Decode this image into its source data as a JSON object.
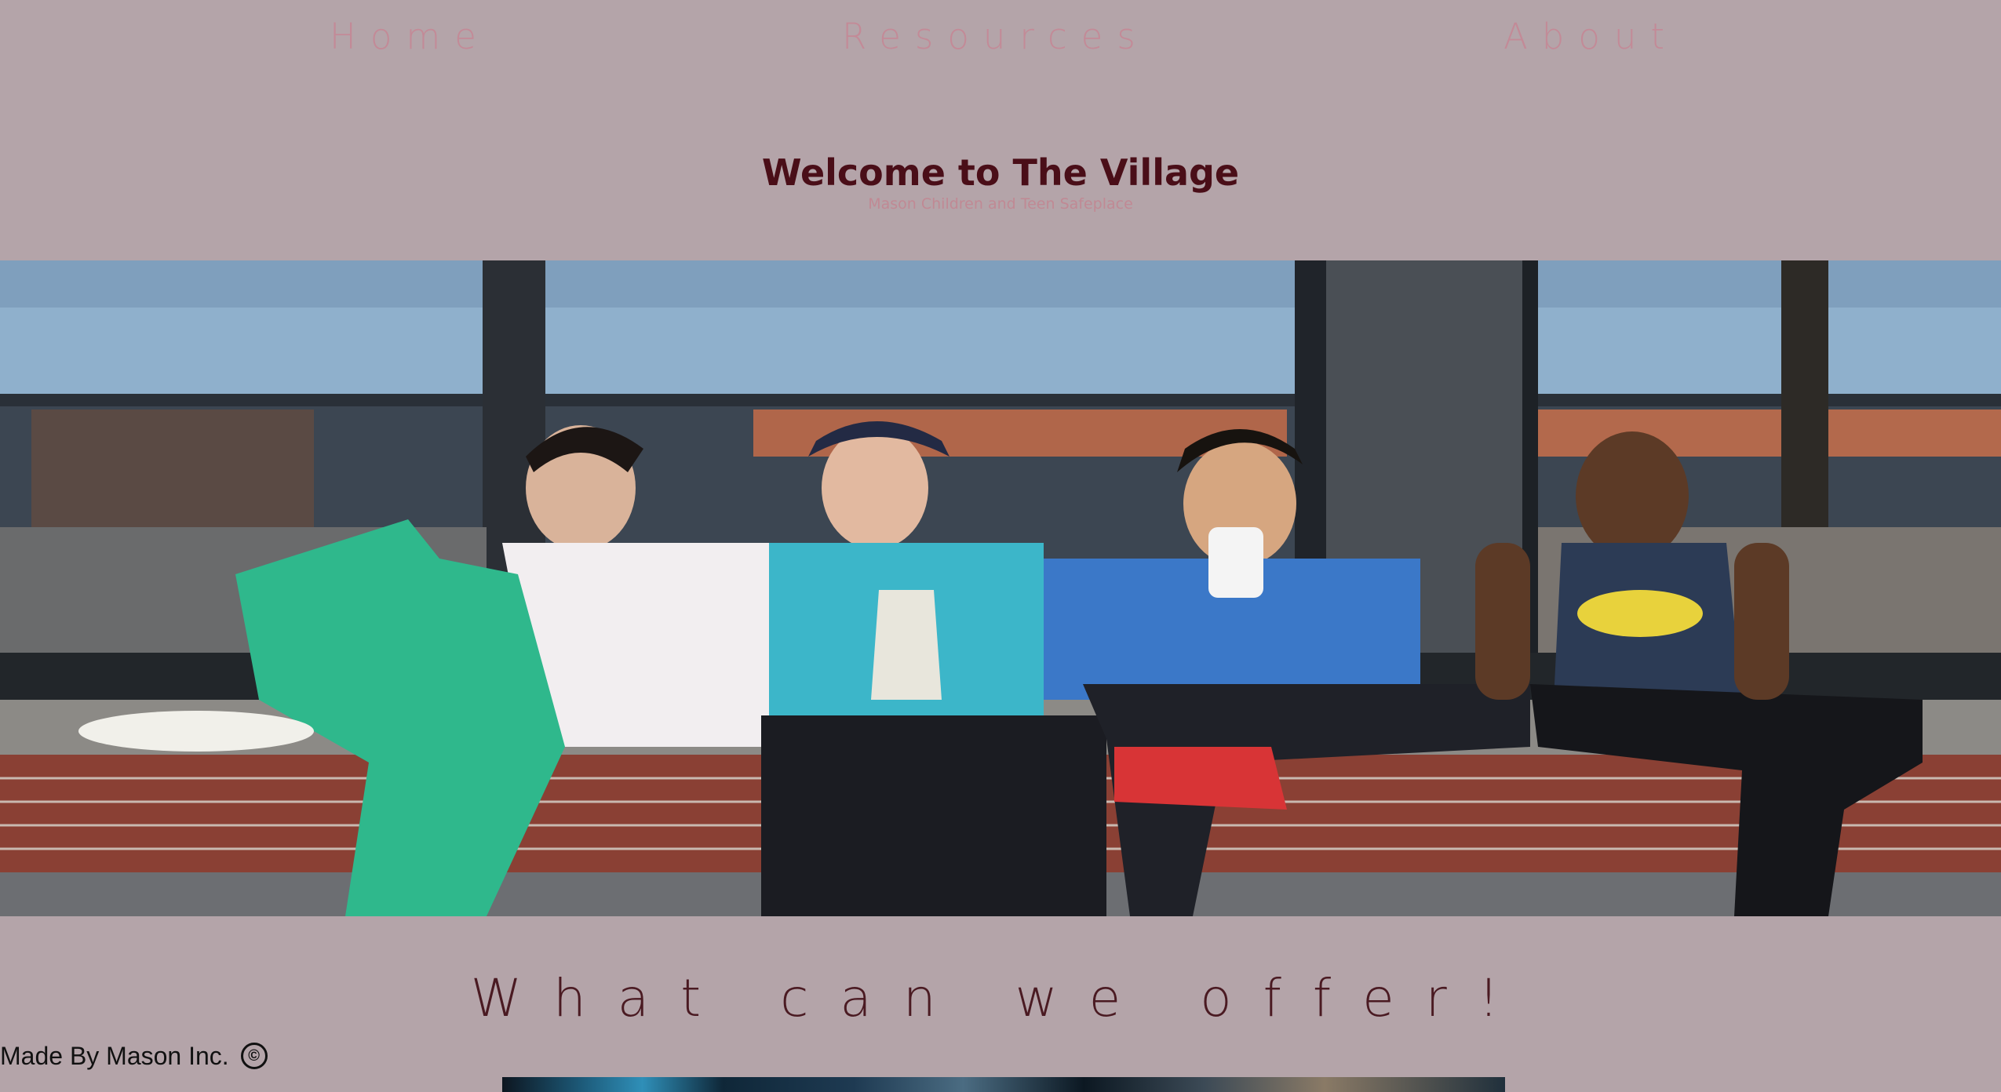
{
  "nav": {
    "home": "Home",
    "resources": "Resources",
    "about": "About"
  },
  "hero": {
    "title": "Welcome to The Village",
    "subtitle": "Mason Children and Teen Safeplace"
  },
  "offer": {
    "heading": "What can we offer!"
  },
  "footer": {
    "credit": "Made By Mason Inc.",
    "copyright_symbol": "©"
  },
  "colors": {
    "page_background": "#b4a4a9",
    "nav_link": "#c38a97",
    "title": "#4a0e18",
    "subtitle": "#c08994",
    "offer_heading": "#4a1a22",
    "credit": "#111111"
  },
  "icons": {
    "copyright": "copyright-icon"
  }
}
